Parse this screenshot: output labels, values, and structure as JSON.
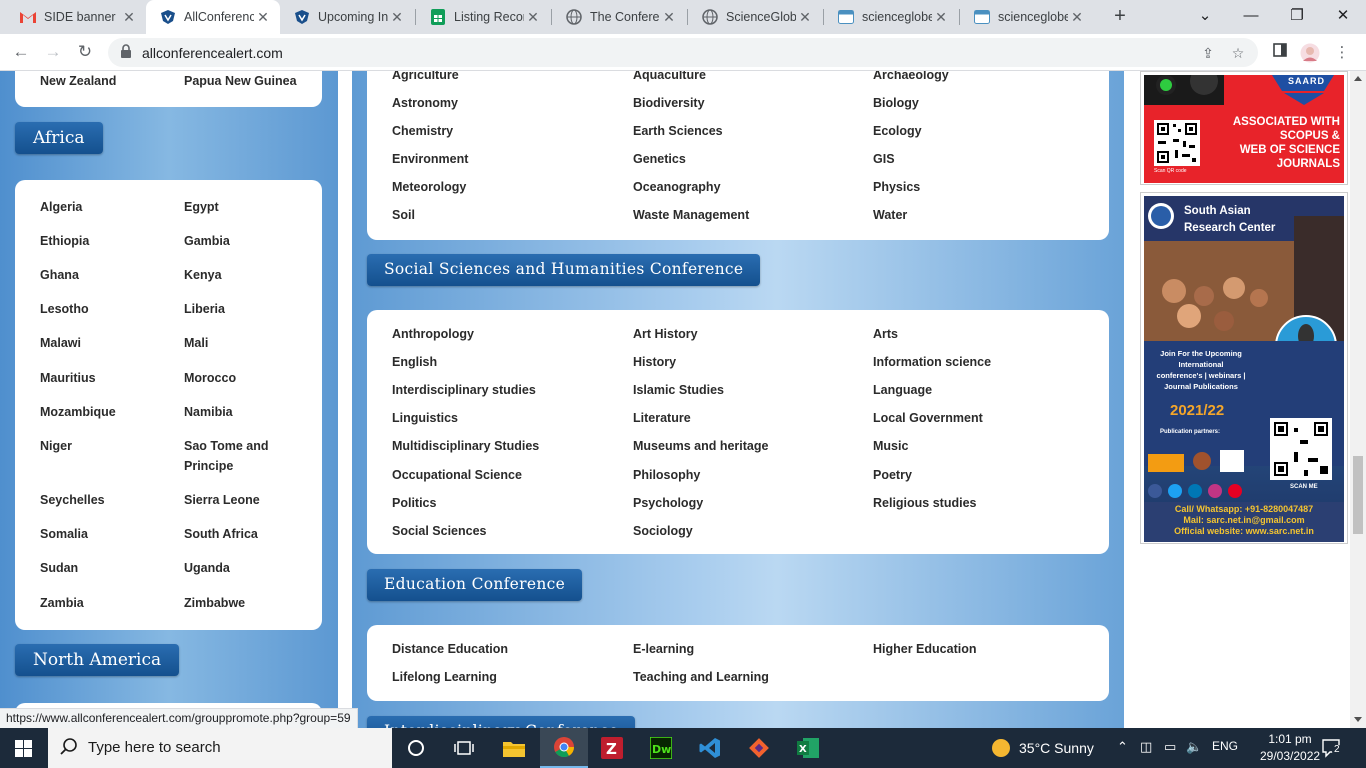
{
  "browser": {
    "tabs": [
      {
        "title": "SIDE banner I",
        "icon": "gmail-icon",
        "active": false
      },
      {
        "title": "AllConference",
        "icon": "allconference-shield-icon",
        "active": true
      },
      {
        "title": "Upcoming Int",
        "icon": "allconference-shield-icon",
        "active": false
      },
      {
        "title": "Listing Record",
        "icon": "sheets-icon",
        "active": false
      },
      {
        "title": "The Conferen",
        "icon": "globe-icon",
        "active": false
      },
      {
        "title": "ScienceGlobe",
        "icon": "globe-icon",
        "active": false
      },
      {
        "title": "scienceglobe",
        "icon": "page-icon",
        "active": false
      },
      {
        "title": "scienceglobe",
        "icon": "page-icon",
        "active": false
      }
    ],
    "new_tab": "+",
    "url": "allconferencealert.com",
    "status_url": "https://www.allconferencealert.com/grouppromote.php?group=59"
  },
  "left": {
    "top_card": {
      "items": [
        "New Zealand",
        "Papua New Guinea"
      ]
    },
    "africa": {
      "heading": "Africa",
      "items": [
        "Algeria",
        "Egypt",
        "Ethiopia",
        "Gambia",
        "Ghana",
        "Kenya",
        "Lesotho",
        "Liberia",
        "Malawi",
        "Mali",
        "Mauritius",
        "Morocco",
        "Mozambique",
        "Namibia",
        "Niger",
        "Sao Tome and Principe",
        "Seychelles",
        "Sierra Leone",
        "Somalia",
        "South Africa",
        "Sudan",
        "Uganda",
        "Zambia",
        "Zimbabwe"
      ]
    },
    "north_america": {
      "heading": "North America"
    }
  },
  "center": {
    "science_card": {
      "items": [
        "Agriculture",
        "Aquaculture",
        "Archaeology",
        "Astronomy",
        "Biodiversity",
        "Biology",
        "Chemistry",
        "Earth Sciences",
        "Ecology",
        "Environment",
        "Genetics",
        "GIS",
        "Meteorology",
        "Oceanography",
        "Physics",
        "Soil",
        "Waste Management",
        "Water"
      ]
    },
    "social": {
      "heading": "Social Sciences and Humanities Conference",
      "items": [
        "Anthropology",
        "Art History",
        "Arts",
        "English",
        "History",
        "Information science",
        "Interdisciplinary studies",
        "Islamic Studies",
        "Language",
        "Linguistics",
        "Literature",
        "Local Government",
        "Multidisciplinary Studies",
        "Museums and heritage",
        "Music",
        "Occupational Science",
        "Philosophy",
        "Poetry",
        "Politics",
        "Psychology",
        "Religious studies",
        "Social Sciences",
        "Sociology"
      ]
    },
    "education": {
      "heading": "Education Conference",
      "items": [
        "Distance Education",
        "E-learning",
        "Higher Education",
        "Lifelong Learning",
        "Teaching and Learning"
      ]
    },
    "next_heading": "Interdisciplinary Conference"
  },
  "ads": {
    "saard": {
      "brand": "SAARD",
      "text": [
        "ASSOCIATED WITH",
        "SCOPUS &",
        "WEB OF SCIENCE",
        "JOURNALS"
      ],
      "qr_caption": "Scan QR code"
    },
    "sarc": {
      "title_line1": "South Asian",
      "title_line2": "Research Center",
      "join": [
        "Join For the Upcoming",
        "International",
        "conference's | webinars |",
        "Journal Publications"
      ],
      "year": "2021/22",
      "partners": "Publication partners:",
      "scan": "SCAN ME",
      "call": "Call/ Whatsapp: +91-8280047487",
      "mail": "Mail: sarc.net.in@gmail.com",
      "web": "Official website: www.sarc.net.in"
    }
  },
  "taskbar": {
    "search_placeholder": "Type here to search",
    "weather": "35°C  Sunny",
    "language": "ENG",
    "time": "1:01 pm",
    "date": "29/03/2022",
    "notifications": "2"
  }
}
